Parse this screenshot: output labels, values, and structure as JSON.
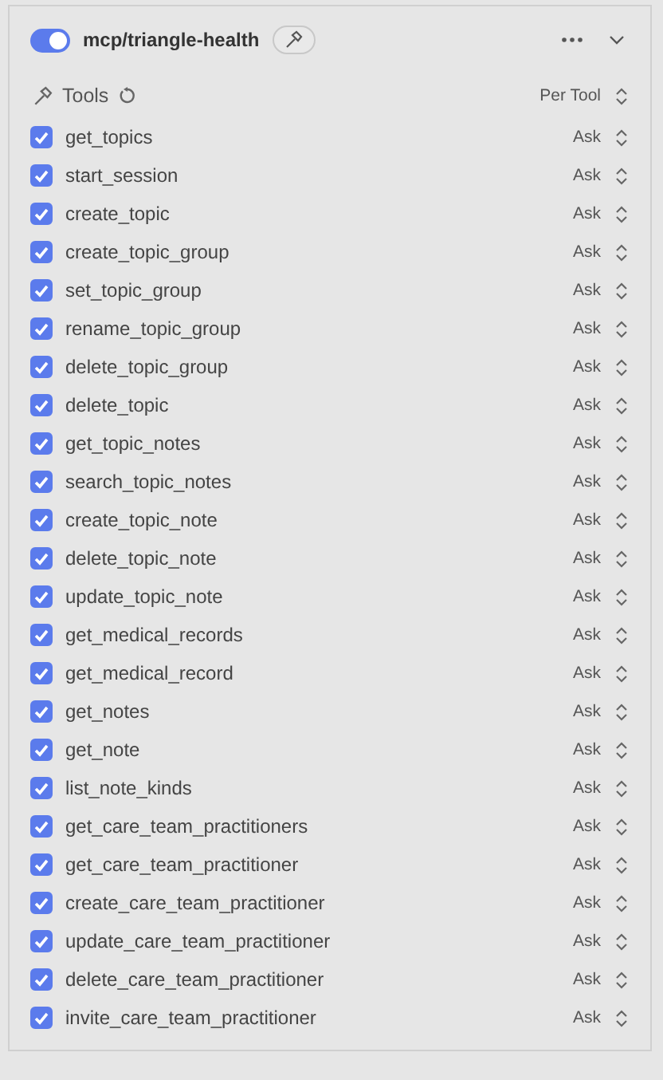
{
  "server": {
    "name": "mcp/triangle-health",
    "enabled": true,
    "expanded": true
  },
  "tools_header": {
    "label": "Tools",
    "mode": "Per Tool"
  },
  "tools": [
    {
      "name": "get_topics",
      "checked": true,
      "permission": "Ask"
    },
    {
      "name": "start_session",
      "checked": true,
      "permission": "Ask"
    },
    {
      "name": "create_topic",
      "checked": true,
      "permission": "Ask"
    },
    {
      "name": "create_topic_group",
      "checked": true,
      "permission": "Ask"
    },
    {
      "name": "set_topic_group",
      "checked": true,
      "permission": "Ask"
    },
    {
      "name": "rename_topic_group",
      "checked": true,
      "permission": "Ask"
    },
    {
      "name": "delete_topic_group",
      "checked": true,
      "permission": "Ask"
    },
    {
      "name": "delete_topic",
      "checked": true,
      "permission": "Ask"
    },
    {
      "name": "get_topic_notes",
      "checked": true,
      "permission": "Ask"
    },
    {
      "name": "search_topic_notes",
      "checked": true,
      "permission": "Ask"
    },
    {
      "name": "create_topic_note",
      "checked": true,
      "permission": "Ask"
    },
    {
      "name": "delete_topic_note",
      "checked": true,
      "permission": "Ask"
    },
    {
      "name": "update_topic_note",
      "checked": true,
      "permission": "Ask"
    },
    {
      "name": "get_medical_records",
      "checked": true,
      "permission": "Ask"
    },
    {
      "name": "get_medical_record",
      "checked": true,
      "permission": "Ask"
    },
    {
      "name": "get_notes",
      "checked": true,
      "permission": "Ask"
    },
    {
      "name": "get_note",
      "checked": true,
      "permission": "Ask"
    },
    {
      "name": "list_note_kinds",
      "checked": true,
      "permission": "Ask"
    },
    {
      "name": "get_care_team_practitioners",
      "checked": true,
      "permission": "Ask"
    },
    {
      "name": "get_care_team_practitioner",
      "checked": true,
      "permission": "Ask"
    },
    {
      "name": "create_care_team_practitioner",
      "checked": true,
      "permission": "Ask"
    },
    {
      "name": "update_care_team_practitioner",
      "checked": true,
      "permission": "Ask"
    },
    {
      "name": "delete_care_team_practitioner",
      "checked": true,
      "permission": "Ask"
    },
    {
      "name": "invite_care_team_practitioner",
      "checked": true,
      "permission": "Ask"
    }
  ]
}
